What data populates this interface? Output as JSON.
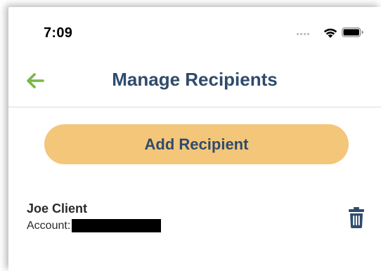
{
  "status_bar": {
    "time": "7:09",
    "icons": [
      "signal-icon",
      "wifi-icon",
      "battery-icon"
    ]
  },
  "header": {
    "title": "Manage Recipients",
    "back_icon": "arrow-left-icon"
  },
  "actions": {
    "add_recipient_label": "Add Recipient"
  },
  "recipients": [
    {
      "name": "Joe Client",
      "account_label": "Account:",
      "account_value_redacted": true,
      "delete_icon": "trash-icon"
    }
  ],
  "colors": {
    "accent_green": "#7ab648",
    "title_navy": "#2f4b6b",
    "button_orange": "#f4c67a",
    "text_dark": "#2a2a2a"
  }
}
